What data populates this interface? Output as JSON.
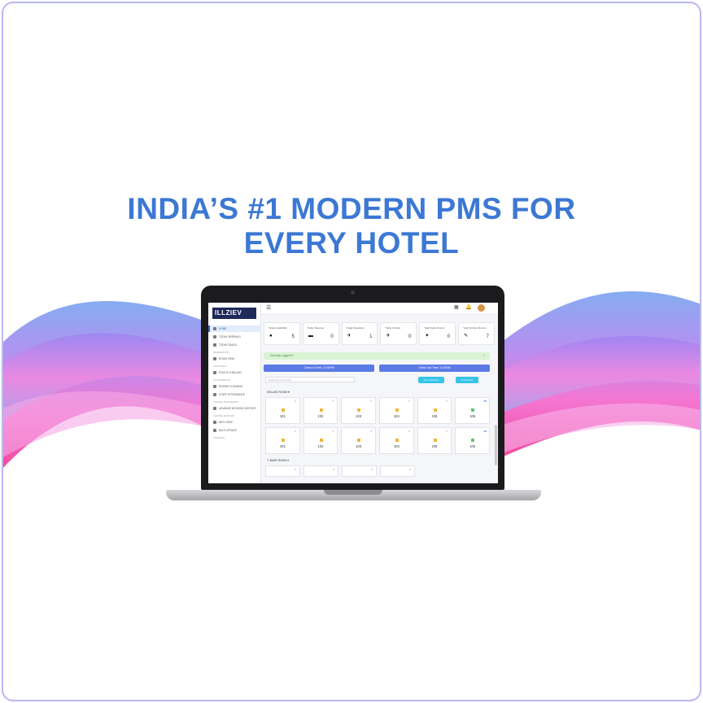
{
  "headline": {
    "line1": "INDIA’S #1 MODERN PMS FOR",
    "line2": "EVERY HOTEL"
  },
  "colors": {
    "headline": "#3c78d4",
    "border": "#b9b8f0",
    "accent": "#5b7ae6",
    "cyan": "#36c3e6"
  },
  "app": {
    "logo": "ILLZIEV",
    "menu_icon": "☰",
    "topbar_icons": [
      "calculator-icon",
      "bell-icon"
    ],
    "nav": [
      {
        "type": "item",
        "label": "HOME",
        "active": true
      },
      {
        "type": "item",
        "label": "TODAY ARRIVALS"
      },
      {
        "type": "item",
        "label": "TODAY SALES"
      },
      {
        "type": "header",
        "label": "RESERVATIONS"
      },
      {
        "type": "item",
        "label": "ROOM VIEW"
      },
      {
        "type": "header",
        "label": "FRONT DESK"
      },
      {
        "type": "item",
        "label": "POLICE & BILLING"
      },
      {
        "type": "header",
        "label": "HOUSEKEEPING"
      },
      {
        "type": "item",
        "label": "ROOMS CLEANING"
      },
      {
        "type": "item",
        "label": "STAFF ATTENDANCE"
      },
      {
        "type": "header",
        "label": "CHANNEL MANAGEMENT"
      },
      {
        "type": "item",
        "label": "ADVANCE BOOKING HISTORY"
      },
      {
        "type": "header",
        "label": "CHANNEL MANAGER"
      },
      {
        "type": "item",
        "label": "INFO VIEW"
      },
      {
        "type": "item",
        "label": "BULK UPDATE"
      },
      {
        "type": "header",
        "label": "CHANNELS"
      }
    ],
    "stats": [
      {
        "label": "Today Availability",
        "value": "5",
        "icon": "●"
      },
      {
        "label": "Today Stayover",
        "value": "0",
        "icon": "▬"
      },
      {
        "label": "Today Departure",
        "value": "1",
        "icon": "✈"
      },
      {
        "label": "Today Arrivals",
        "value": "0",
        "icon": "✈"
      },
      {
        "label": "Total Clean Rooms",
        "value": "0",
        "icon": "✦"
      },
      {
        "label": "Total Unclean Rooms",
        "value": "7",
        "icon": "✎"
      }
    ],
    "alert": {
      "text": "Currently Logged In!",
      "close": "×"
    },
    "check_in": "Check In Time: 12:00PM",
    "check_out": "Check Out Time: 11:00AM",
    "search_placeholder": "Search by Unit name",
    "btn_a": "Live Inventory",
    "btn_b": "Live Guest",
    "sections": [
      {
        "title": "DELUXE ROOM ♥",
        "rows": [
          [
            {
              "no": "101",
              "flag": "red"
            },
            {
              "no": "102",
              "flag": "red"
            },
            {
              "no": "103",
              "flag": "red"
            },
            {
              "no": "104",
              "flag": "red"
            },
            {
              "no": "105",
              "flag": "red"
            },
            {
              "no": "106",
              "flag": "blue",
              "dot": "green"
            }
          ],
          [
            {
              "no": "101",
              "flag": "red"
            },
            {
              "no": "102",
              "flag": "red"
            },
            {
              "no": "103",
              "flag": "red"
            },
            {
              "no": "104",
              "flag": "red"
            },
            {
              "no": "105",
              "flag": "red"
            },
            {
              "no": "106",
              "flag": "blue",
              "dot": "green"
            }
          ]
        ]
      },
      {
        "title": "T. BASE ROOM ♥",
        "rows": [
          [
            {
              "no": "",
              "flag": "red"
            },
            {
              "no": "",
              "flag": "red"
            },
            {
              "no": "",
              "flag": "red"
            },
            {
              "no": "",
              "flag": "red"
            }
          ]
        ]
      }
    ]
  }
}
